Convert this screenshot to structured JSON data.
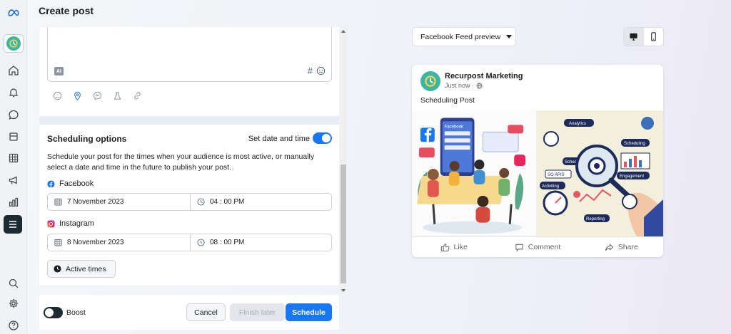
{
  "header": {
    "title": "Create post"
  },
  "sidebar": {
    "logo": "meta-logo-icon",
    "items": [
      "home-icon",
      "bell-icon",
      "chat-icon",
      "pages-icon",
      "table-icon",
      "megaphone-icon",
      "bar-chart-icon",
      "menu-icon"
    ],
    "bottom": [
      "search-icon",
      "gear-icon",
      "help-icon"
    ]
  },
  "editor": {
    "ai_badge": "AI",
    "hashtag": "#",
    "tools": [
      "emoji-icon",
      "location-icon",
      "messenger-icon",
      "flask-icon",
      "link-icon"
    ]
  },
  "scheduling": {
    "title": "Scheduling options",
    "toggle_label": "Set date and time",
    "toggle_on": true,
    "description": "Schedule your post for the times when your audience is most active, or manually select a date and time in the future to publish your post.",
    "facebook": {
      "label": "Facebook",
      "date": "7 November 2023",
      "time": "04 : 00 PM"
    },
    "instagram": {
      "label": "Instagram",
      "date": "8 November 2023",
      "time": "08 : 00 PM"
    },
    "active_times": "Active times"
  },
  "footer": {
    "boost_label": "Boost",
    "boost_on": false,
    "cancel": "Cancel",
    "finish_later": "Finish later",
    "schedule": "Schedule"
  },
  "preview": {
    "selector": "Facebook Feed preview",
    "post": {
      "author": "Recurpost Marketing",
      "time": "Just now ·",
      "text": "Scheduling Post",
      "image_left_labels": {
        "facebook": "Facebook"
      },
      "image_right_labels": {
        "analytics": "Analytics",
        "scheduling": "Scheduling",
        "scheduling2": "Scheduling",
        "apis": "SO APIS",
        "engagement": "Engagement",
        "activity": "Activiting",
        "reporting": "Reporting"
      },
      "actions": {
        "like": "Like",
        "comment": "Comment",
        "share": "Share"
      }
    }
  },
  "colors": {
    "accent": "#1877f2",
    "brand_teal": "#3cb6a4",
    "dark": "#1c2b33"
  }
}
